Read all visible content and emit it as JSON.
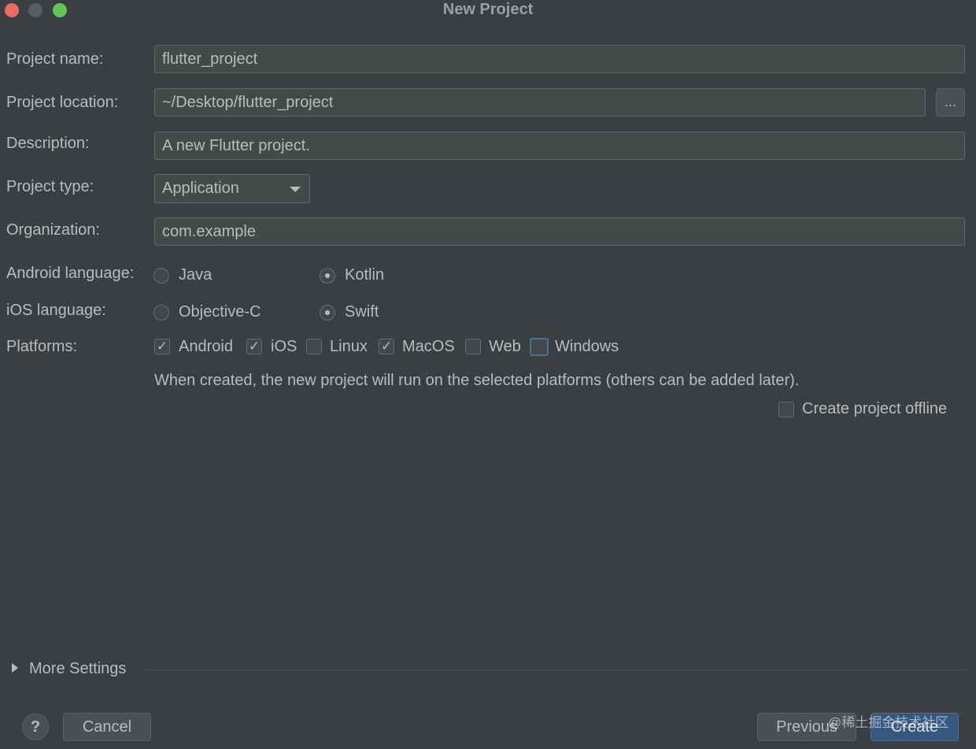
{
  "window": {
    "title": "New Project"
  },
  "form": {
    "project_name": {
      "label": "Project name:",
      "value": "flutter_project"
    },
    "project_location": {
      "label": "Project location:",
      "value": "~/Desktop/flutter_project",
      "browse_label": "..."
    },
    "description": {
      "label": "Description:",
      "value": "A new Flutter project."
    },
    "project_type": {
      "label": "Project type:",
      "value": "Application"
    },
    "organization": {
      "label": "Organization:",
      "value": "com.example"
    },
    "android_language": {
      "label": "Android language:",
      "options": [
        {
          "label": "Java",
          "selected": false
        },
        {
          "label": "Kotlin",
          "selected": true
        }
      ]
    },
    "ios_language": {
      "label": "iOS language:",
      "options": [
        {
          "label": "Objective-C",
          "selected": false
        },
        {
          "label": "Swift",
          "selected": true
        }
      ]
    },
    "platforms": {
      "label": "Platforms:",
      "options": [
        {
          "label": "Android",
          "checked": true
        },
        {
          "label": "iOS",
          "checked": true
        },
        {
          "label": "Linux",
          "checked": false
        },
        {
          "label": "MacOS",
          "checked": true
        },
        {
          "label": "Web",
          "checked": false
        },
        {
          "label": "Windows",
          "checked": false
        }
      ],
      "hint": "When created, the new project will run on the selected platforms (others can be added later)."
    },
    "offline": {
      "label": "Create project offline",
      "checked": false
    }
  },
  "more_settings": {
    "label": "More Settings"
  },
  "footer": {
    "help_label": "?",
    "cancel_label": "Cancel",
    "previous_label": "Previous",
    "create_label": "Create"
  },
  "watermark": "@稀土掘金技术社区"
}
